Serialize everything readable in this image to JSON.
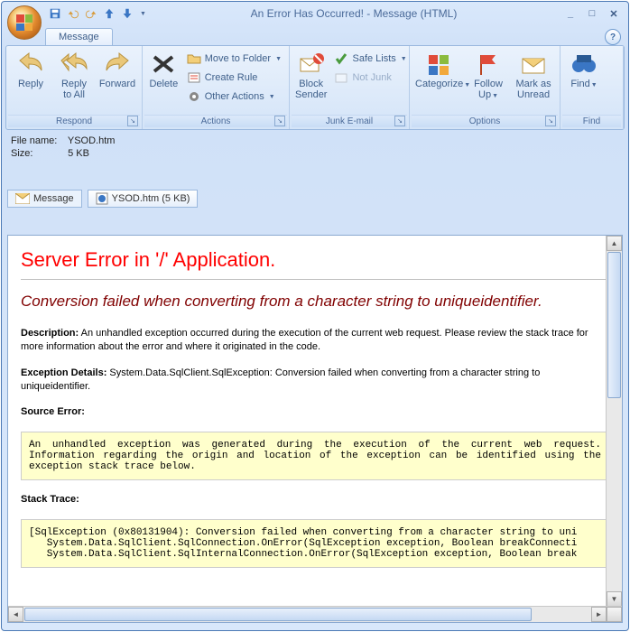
{
  "window": {
    "title": "An Error Has Occurred! - Message (HTML)"
  },
  "qat": {
    "save": "save",
    "undo": "undo",
    "redo": "redo",
    "prev": "prev",
    "next": "next"
  },
  "tab": {
    "message": "Message"
  },
  "ribbon": {
    "respond": {
      "label": "Respond",
      "reply": "Reply",
      "reply_all": "Reply\nto All",
      "forward": "Forward"
    },
    "actions": {
      "label": "Actions",
      "delete": "Delete",
      "move": "Move to Folder",
      "rule": "Create Rule",
      "other": "Other Actions"
    },
    "junk": {
      "label": "Junk E-mail",
      "block": "Block\nSender",
      "safe": "Safe Lists",
      "not_junk": "Not Junk"
    },
    "options": {
      "label": "Options",
      "categorize": "Categorize",
      "follow": "Follow\nUp",
      "unread": "Mark as\nUnread"
    },
    "find": {
      "label": "Find",
      "find": "Find"
    }
  },
  "info": {
    "filename_label": "File name:",
    "filename": "YSOD.htm",
    "size_label": "Size:",
    "size": "5 KB"
  },
  "attach": {
    "message": "Message",
    "file": "YSOD.htm (5 KB)"
  },
  "ysod": {
    "h1": "Server Error in '/' Application.",
    "h2": "Conversion failed when converting from a character string to uniqueidentifier.",
    "desc_label": "Description:",
    "desc": " An unhandled exception occurred during the execution of the current web request. Please review the stack trace for more information about the error and where it originated in the code.",
    "exc_label": "Exception Details:",
    "exc": " System.Data.SqlClient.SqlException: Conversion failed when converting from a character string to uniqueidentifier.",
    "src_label": "Source Error:",
    "src_box": "An unhandled exception was generated during the execution of the current web request. Information regarding the origin and location of the exception can be identified using the exception stack trace below.",
    "trace_label": "Stack Trace:",
    "trace_box": "[SqlException (0x80131904): Conversion failed when converting from a character string to uni\n   System.Data.SqlClient.SqlConnection.OnError(SqlException exception, Boolean breakConnecti\n   System.Data.SqlClient.SqlInternalConnection.OnError(SqlException exception, Boolean break"
  }
}
